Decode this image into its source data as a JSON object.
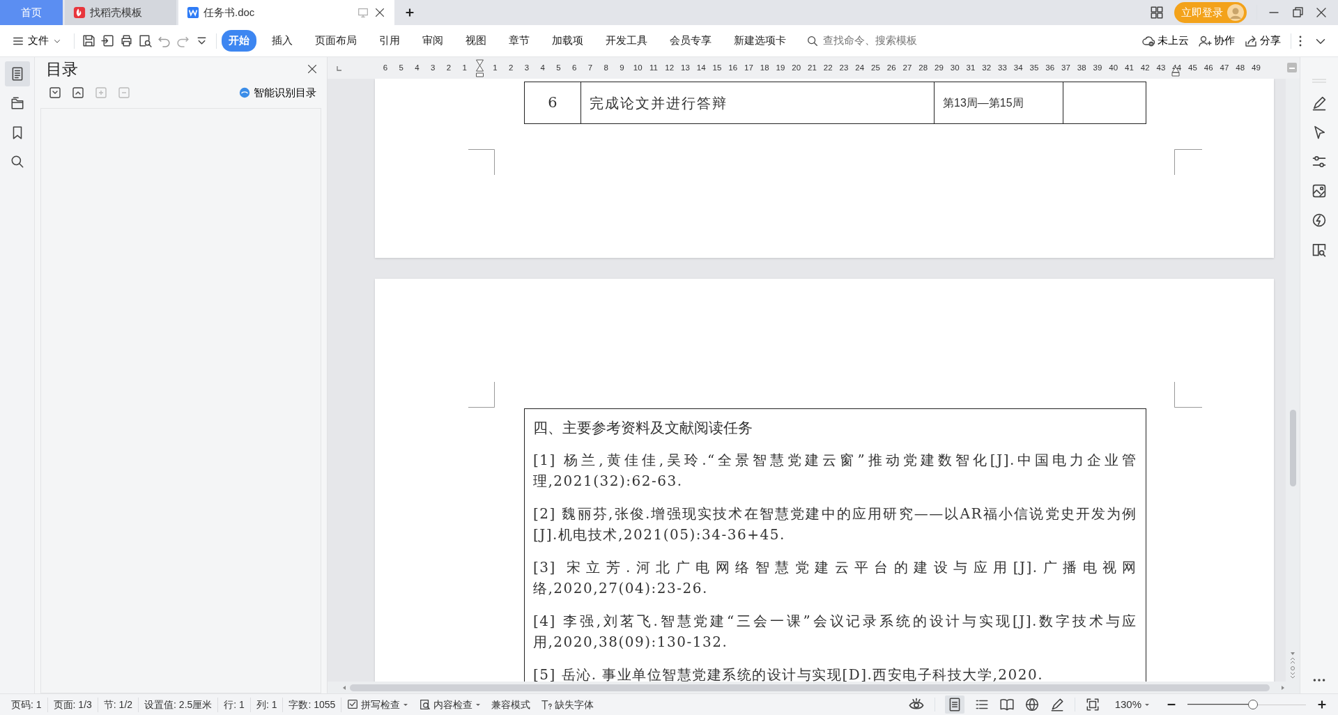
{
  "tabs": [
    {
      "label": "首页",
      "kind": "home",
      "selected": false
    },
    {
      "label": "找稻壳模板",
      "kind": "template",
      "selected": false
    },
    {
      "label": "任务书.doc",
      "kind": "document",
      "selected": true
    }
  ],
  "account": {
    "login_label": "立即登录"
  },
  "menu": {
    "file_label": "文件"
  },
  "ribbon_tabs": [
    {
      "label": "开始",
      "selected": true
    },
    {
      "label": "插入",
      "selected": false
    },
    {
      "label": "页面布局",
      "selected": false
    },
    {
      "label": "引用",
      "selected": false
    },
    {
      "label": "审阅",
      "selected": false
    },
    {
      "label": "视图",
      "selected": false
    },
    {
      "label": "章节",
      "selected": false
    },
    {
      "label": "加载项",
      "selected": false
    },
    {
      "label": "开发工具",
      "selected": false
    },
    {
      "label": "会员专享",
      "selected": false
    },
    {
      "label": "新建选项卡",
      "selected": false
    }
  ],
  "search": {
    "placeholder": "查找命令、搜索模板"
  },
  "actions": [
    {
      "label": "未上云",
      "kind": "cloud"
    },
    {
      "label": "协作",
      "kind": "collab"
    },
    {
      "label": "分享",
      "kind": "share"
    }
  ],
  "rail_items": [
    {
      "kind": "outline",
      "selected": true
    },
    {
      "kind": "folder",
      "selected": false
    },
    {
      "kind": "bookmark",
      "selected": false
    },
    {
      "kind": "search",
      "selected": false
    }
  ],
  "outline_panel": {
    "title": "目录",
    "smart_label": "智能识别目录"
  },
  "ruler": {
    "left_numbers": [
      "6",
      "5",
      "4",
      "3",
      "2",
      "1"
    ],
    "right_numbers": [
      "1",
      "2",
      "3",
      "4",
      "5",
      "6",
      "7",
      "8",
      "9",
      "10",
      "11",
      "12",
      "13",
      "14",
      "15",
      "16",
      "17",
      "18",
      "19",
      "20",
      "21",
      "22",
      "23",
      "24",
      "25",
      "26",
      "27",
      "28",
      "29",
      "30",
      "31",
      "32",
      "33",
      "34",
      "35",
      "36",
      "37",
      "38",
      "39",
      "40",
      "41",
      "42",
      "43",
      "44",
      "45",
      "46",
      "47",
      "48",
      "49"
    ]
  },
  "document": {
    "table_row": {
      "number": "6",
      "task": "完成论文并进行答辩",
      "weeks": "第13周—第15周"
    },
    "references": {
      "heading": "四、主要参考资料及文献阅读任务",
      "items": [
        "[1] 杨兰,黄佳佳,吴玲.“全景智慧党建云窗”推动党建数智化[J].中国电力企业管理,2021(32):62-63.",
        "[2] 魏丽芬,张俊.增强现实技术在智慧党建中的应用研究——以AR福小信说党史开发为例[J].机电技术,2021(05):34-36+45.",
        "[3] 宋立芳.河北广电网络智慧党建云平台的建设与应用[J].广播电视网络,2020,27(04):23-26.",
        "[4] 李强,刘茗飞.智慧党建“三会一课”会议记录系统的设计与实现[J].数字技术与应用,2020,38(09):130-132.",
        "[5] 岳沁. 事业单位智慧党建系统的设计与实现[D].西安电子科技大学,2020."
      ]
    }
  },
  "status_bar": {
    "items": [
      "页码: 1",
      "页面: 1/3",
      "节: 1/2",
      "设置值: 2.5厘米",
      "行: 1",
      "列: 1",
      "字数: 1055"
    ],
    "tools": [
      {
        "label": "拼写检查",
        "kind": "spell"
      },
      {
        "label": "内容检查",
        "kind": "content"
      },
      {
        "label": "兼容模式",
        "kind": "plain"
      },
      {
        "label": "缺失字体",
        "kind": "font"
      }
    ],
    "zoom": {
      "label": "130%",
      "level": 0.55
    }
  }
}
